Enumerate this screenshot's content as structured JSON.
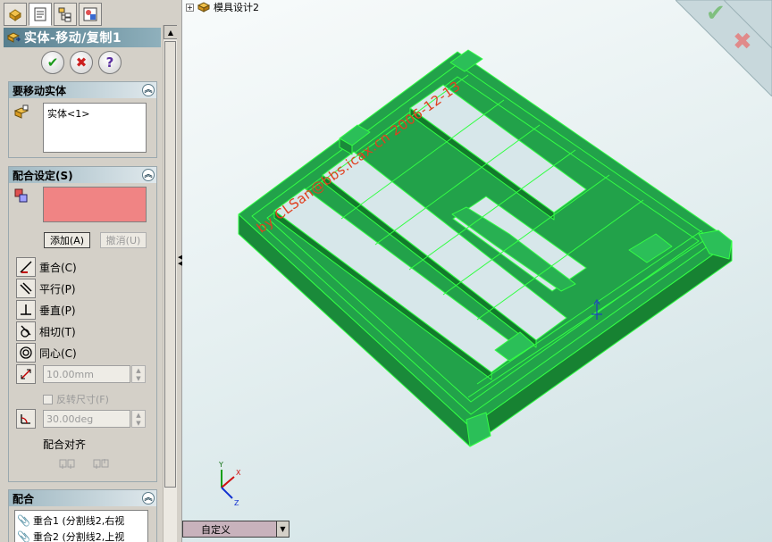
{
  "property_manager": {
    "title": "实体-移动/复制1",
    "tabs": [
      "feature-manager-icon",
      "property-manager-icon",
      "configuration-manager-icon",
      "display-manager-icon"
    ],
    "buttons": {
      "ok": "✔",
      "cancel": "✖",
      "help": "?"
    },
    "bodies_group": {
      "header": "要移动实体",
      "items": [
        "实体<1>"
      ]
    },
    "mate_settings": {
      "header": "配合设定(S)",
      "add_button": "添加(A)",
      "undo_button": "撤消(U)",
      "mate_types": [
        {
          "label": "重合(C)",
          "icon": "coincident-icon"
        },
        {
          "label": "平行(P)",
          "icon": "parallel-icon"
        },
        {
          "label": "垂直(P)",
          "icon": "perpendicular-icon"
        },
        {
          "label": "相切(T)",
          "icon": "tangent-icon"
        },
        {
          "label": "同心(C)",
          "icon": "concentric-icon"
        }
      ],
      "distance_value": "10.00mm",
      "flip_dimension_label": "反转尺寸(F)",
      "angle_value": "30.00deg",
      "mate_alignment_label": "配合对齐"
    },
    "mates_group": {
      "header": "配合",
      "items": [
        "重合1 (分割线2,右视",
        "重合2 (分割线2,上视"
      ]
    }
  },
  "viewport": {
    "tree_node_label": "模具设计2",
    "watermark": "by CLSan@bbs.icax.cn 2006-12-13",
    "view_orientation": "自定义",
    "model_color": "#22a24a",
    "edge_color": "#33ff44",
    "confirm": {
      "ok": "✔",
      "cancel": "✖"
    },
    "triad_axes": [
      "X",
      "Y",
      "Z"
    ]
  }
}
